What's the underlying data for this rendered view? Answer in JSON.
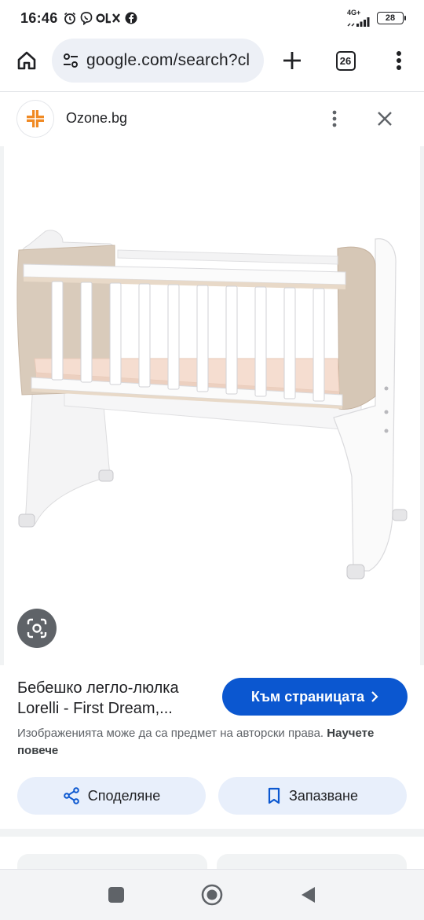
{
  "status_bar": {
    "time": "16:46",
    "network": "4G+",
    "battery": "28"
  },
  "toolbar": {
    "url": "google.com/search?cl",
    "tab_count": "26"
  },
  "result": {
    "source": "Ozone.bg",
    "title_line1": "Бебешко легло-люлка",
    "title_line2": "Lorelli - First Dream,...",
    "visit_label": "Към страницата",
    "copyright": "Изображенията може да са предмет на авторски права.",
    "learn_more": "Научете повече",
    "share_label": "Споделяне",
    "save_label": "Запазване"
  },
  "colors": {
    "accent": "#0b57d0",
    "pill_bg": "#e8effb",
    "omnibox_bg": "#edf0f6",
    "favicon_orange": "#f08a24"
  },
  "icons": {
    "home": "home-icon",
    "site_settings": "tune-icon",
    "new_tab": "plus-icon",
    "menu": "more-vert-icon",
    "close": "close-icon",
    "lens": "lens-icon",
    "share": "share-icon",
    "bookmark": "bookmark-icon"
  }
}
